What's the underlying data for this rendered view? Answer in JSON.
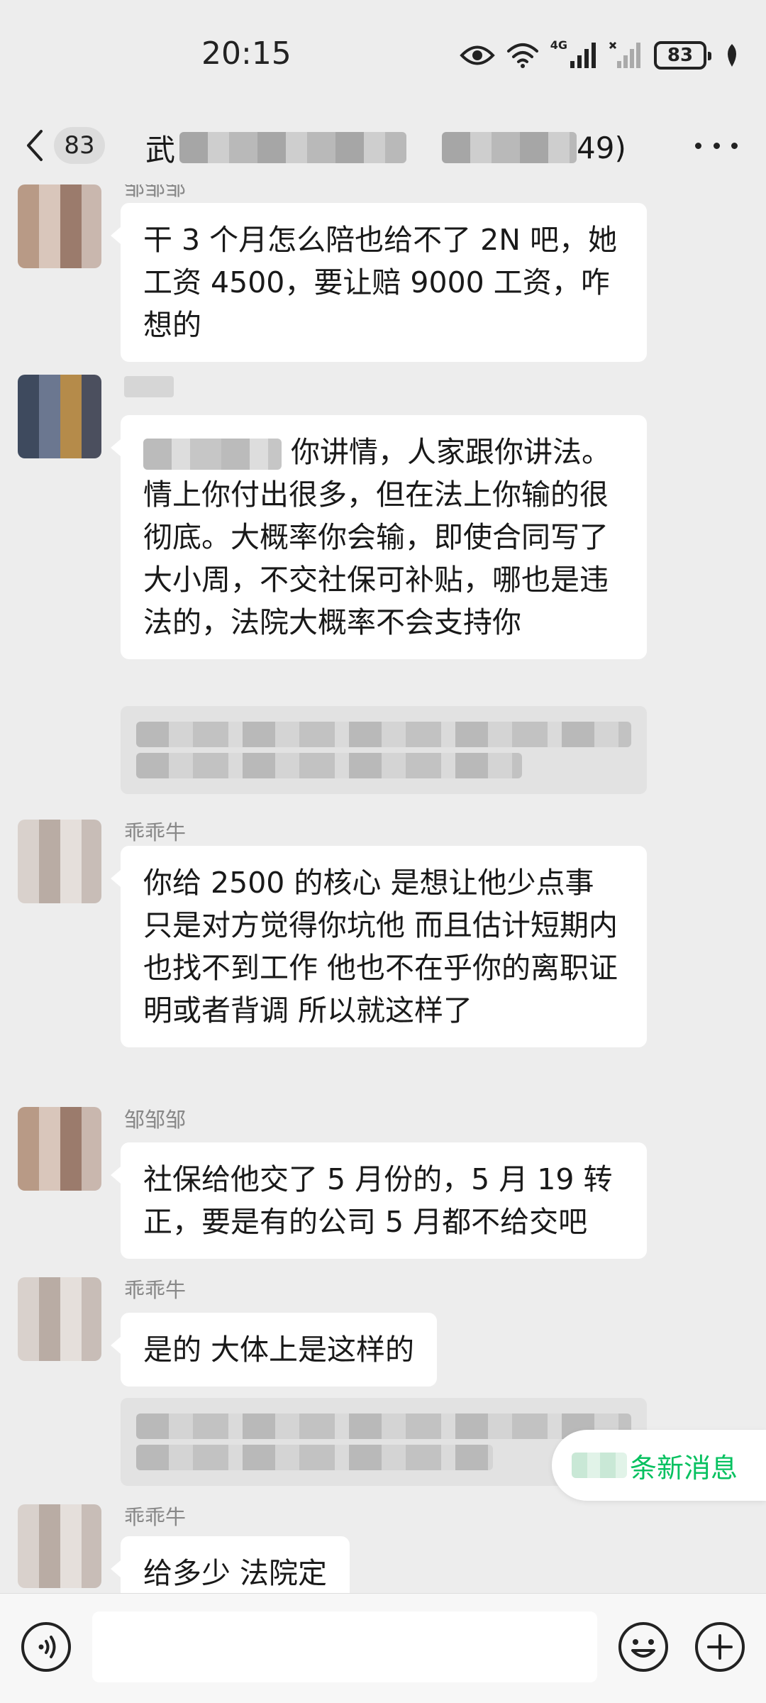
{
  "status_bar": {
    "time": "20:15",
    "network_label": "4G",
    "battery": "83"
  },
  "header": {
    "unread_count": "83",
    "title_visible_start": "武",
    "title_visible_end": "49)"
  },
  "messages": [
    {
      "sender": "邹邹邹",
      "text": "干 3 个月怎么陪也给不了 2N 吧，她工资 4500，要让赔 9000 工资，咋想的"
    },
    {
      "sender": "",
      "text": "你讲情，人家跟你讲法。情上你付出很多，但在法上你输的很彻底。大概率你会输，即使合同写了大小周，不交社保可补贴，哪也是违法的，法院大概率不会支持你"
    },
    {
      "sender": "乖乖牛",
      "text": "你给 2500 的核心 是想让他少点事 只是对方觉得你坑他 而且估计短期内也找不到工作 他也不在乎你的离职证明或者背调 所以就这样了"
    },
    {
      "sender": "邹邹邹",
      "text": "社保给他交了 5 月份的，5 月 19 转正，要是有的公司 5 月都不给交吧"
    },
    {
      "sender": "乖乖牛",
      "text": "是的 大体上是这样的"
    },
    {
      "sender": "乖乖牛",
      "text": "给多少 法院定"
    }
  ],
  "new_messages_pill": "条新消息",
  "colors": {
    "background": "#ededed",
    "bubble": "#ffffff",
    "accent_green": "#07c160",
    "nickname": "#888888"
  },
  "icons": {
    "back": "chevron-left-icon",
    "more": "more-dots-icon",
    "voice": "voice-icon",
    "emoji": "emoji-icon",
    "plus": "plus-icon"
  }
}
